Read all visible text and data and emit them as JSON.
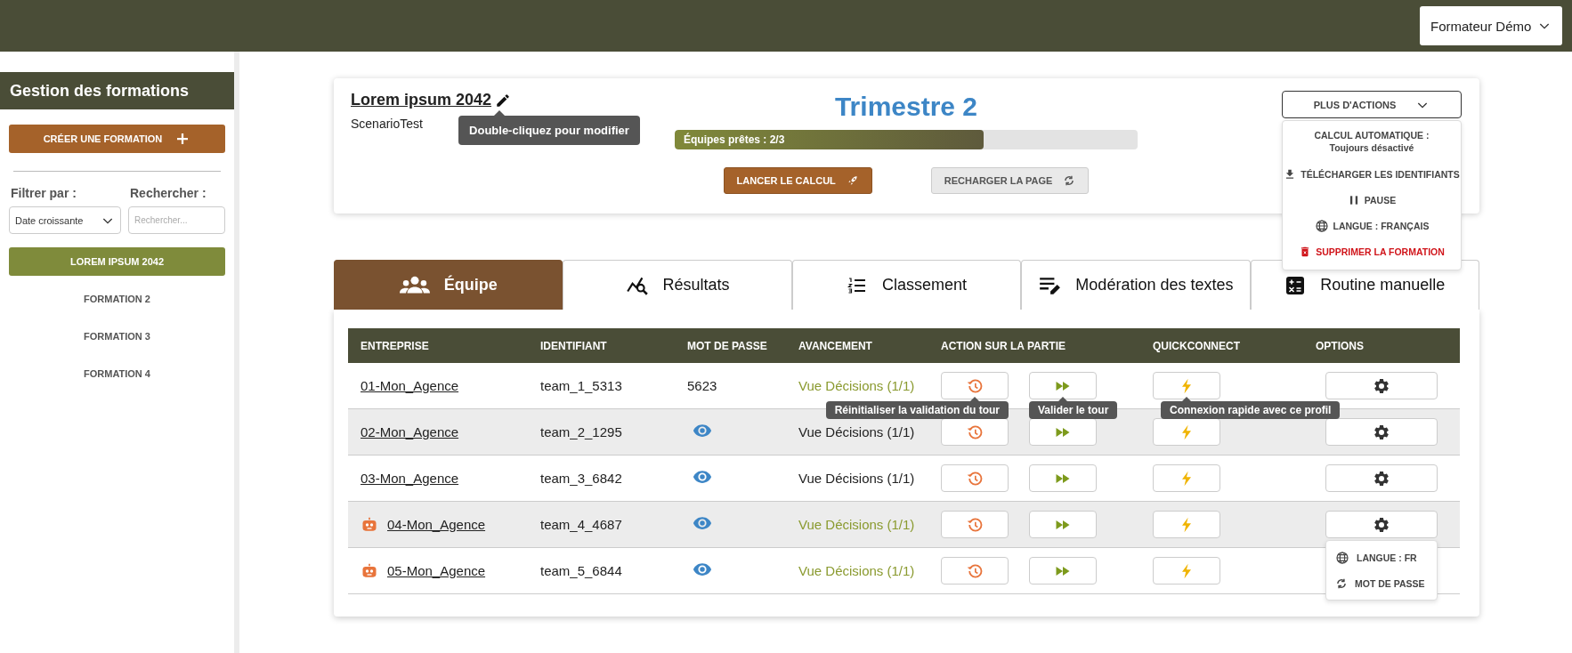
{
  "top_bar": {
    "user_menu": "Formateur Démo"
  },
  "sidebar": {
    "title": "Gestion des formations",
    "create_button": "CRÉER UNE FORMATION",
    "filter_label": "Filtrer par :",
    "filter_value": "Date croissante",
    "search_label": "Rechercher :",
    "search_placeholder": "Rechercher...",
    "items": [
      {
        "label": "LOREM IPSUM 2042",
        "selected": true
      },
      {
        "label": "FORMATION 2",
        "selected": false
      },
      {
        "label": "FORMATION 3",
        "selected": false
      },
      {
        "label": "FORMATION 4",
        "selected": false
      }
    ]
  },
  "header": {
    "title": "Lorem ipsum 2042",
    "subtitle": "ScenarioTest",
    "tooltip": "Double-cliquez pour modifier",
    "period": "Trimestre 2",
    "progress": {
      "label": "Équipes prêtes : 2/3",
      "level": 0.667
    },
    "buttons": [
      {
        "label": "LANCER LE CALCUL",
        "kind": "launch"
      },
      {
        "label": "RECHARGER LA PAGE",
        "kind": "reload"
      }
    ],
    "actions_button": "PLUS D'ACTIONS",
    "actions_menu": [
      {
        "kind": "info",
        "label": "CALCUL AUTOMATIQUE :",
        "detail": "Toujours désactivé"
      },
      {
        "kind": "download",
        "label": "TÉLÉCHARGER LES IDENTIFIANTS"
      },
      {
        "kind": "pause",
        "label": "PAUSE"
      },
      {
        "kind": "language",
        "label": "LANGUE : FRANÇAIS"
      },
      {
        "kind": "delete",
        "label": "SUPPRIMER LA FORMATION"
      }
    ]
  },
  "tabs": [
    {
      "label": "Équipe",
      "kind": "team",
      "selected": true
    },
    {
      "label": "Résultats",
      "kind": "results",
      "selected": false
    },
    {
      "label": "Classement",
      "kind": "ranking",
      "selected": false
    },
    {
      "label": "Modération des textes",
      "kind": "moderation",
      "selected": false
    },
    {
      "label": "Routine manuelle",
      "kind": "routine",
      "selected": false
    }
  ],
  "table": {
    "columns": [
      "ENTREPRISE",
      "IDENTIFIANT",
      "MOT DE PASSE",
      "AVANCEMENT",
      "ACTION SUR LA PARTIE",
      "QUICKCONNECT",
      "OPTIONS"
    ],
    "rows": [
      {
        "company": "01-Mon_Agence",
        "bot": false,
        "login": "team_1_5313",
        "password": "5623",
        "progress": "Vue Décisions (1/1)",
        "complete": true,
        "tooltips": [
          "Réinitialiser la validation du tour",
          "Valider le tour",
          "Connexion rapide avec ce profil"
        ]
      },
      {
        "company": "02-Mon_Agence",
        "bot": false,
        "login": "team_2_1295",
        "progress": "Vue Décisions (1/1)",
        "complete": false
      },
      {
        "company": "03-Mon_Agence",
        "bot": false,
        "login": "team_3_6842",
        "progress": "Vue Décisions (1/1)",
        "complete": false
      },
      {
        "company": "04-Mon_Agence",
        "bot": true,
        "login": "team_4_4687",
        "progress": "Vue Décisions (1/1)",
        "complete": true,
        "options_menu": [
          {
            "kind": "language",
            "label": "LANGUE : FR"
          },
          {
            "kind": "reset",
            "label": "MOT DE PASSE"
          }
        ]
      },
      {
        "company": "05-Mon_Agence",
        "bot": true,
        "login": "team_5_6844",
        "progress": "Vue Décisions (1/1)",
        "complete": true
      }
    ]
  }
}
